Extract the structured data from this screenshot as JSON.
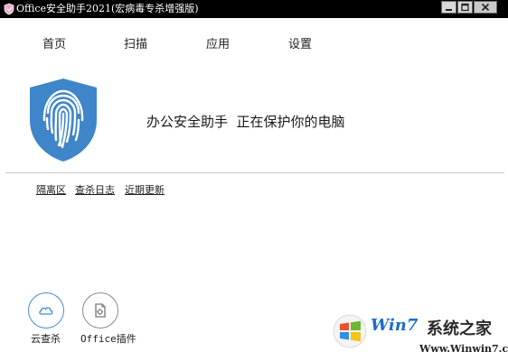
{
  "window": {
    "title": "Office安全助手2021(宏病毒专杀增强版)",
    "minimize_icon": "minimize-icon",
    "maximize_icon": "maximize-icon",
    "close_icon": "close-icon"
  },
  "nav": {
    "items": [
      {
        "label": "首页"
      },
      {
        "label": "扫描"
      },
      {
        "label": "应用"
      },
      {
        "label": "设置"
      }
    ]
  },
  "status": {
    "icon": "fingerprint-shield-icon",
    "message": "办公安全助手  正在保护你的电脑"
  },
  "links": {
    "items": [
      {
        "label": "隔离区"
      },
      {
        "label": "查杀日志"
      },
      {
        "label": "近期更新"
      }
    ]
  },
  "tools": {
    "items": [
      {
        "label": "云查杀",
        "icon": "cloud-icon"
      },
      {
        "label": "Office插件",
        "icon": "office-plugin-icon"
      }
    ]
  },
  "watermark": {
    "brand": "Win7",
    "name": "系统之家",
    "url": "Www.Winwin7.com"
  },
  "colors": {
    "titlebar": "#000000",
    "shield": "#3e86c9",
    "accent": "#3e8fd1"
  }
}
